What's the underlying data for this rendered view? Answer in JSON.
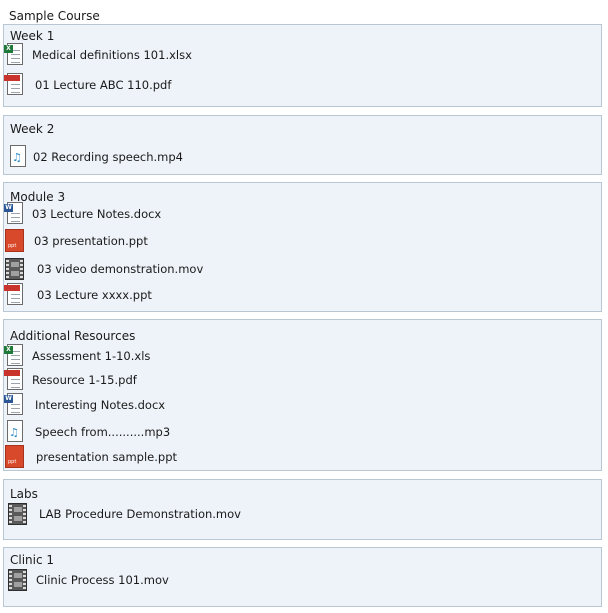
{
  "course": {
    "title": "Sample Course"
  },
  "sections": [
    {
      "title": "Week 1",
      "files": [
        {
          "name": "Medical definitions 101.xlsx",
          "icon": "excel-icon"
        },
        {
          "name": "01 Lecture ABC 110.pdf",
          "icon": "pdf-icon"
        }
      ]
    },
    {
      "title": "Week 2",
      "files": [
        {
          "name": "02 Recording speech.mp4",
          "icon": "audio-icon"
        }
      ]
    },
    {
      "title": "Module 3",
      "files": [
        {
          "name": "03 Lecture Notes.docx",
          "icon": "word-icon"
        },
        {
          "name": "03 presentation.ppt",
          "icon": "powerpoint-icon"
        },
        {
          "name": "03 video demonstration.mov",
          "icon": "video-icon"
        },
        {
          "name": "03 Lecture xxxx.ppt",
          "icon": "pdf-icon"
        }
      ]
    },
    {
      "title": "Additional Resources",
      "files": [
        {
          "name": "Assessment 1-10.xls",
          "icon": "excel-icon"
        },
        {
          "name": "Resource 1-15.pdf",
          "icon": "pdf-icon"
        },
        {
          "name": "Interesting Notes.docx",
          "icon": "word-icon"
        },
        {
          "name": "Speech from..........mp3",
          "icon": "audio-icon"
        },
        {
          "name": "presentation sample.ppt",
          "icon": "powerpoint-icon"
        }
      ]
    },
    {
      "title": "Labs",
      "files": [
        {
          "name": "LAB Procedure Demonstration.mov",
          "icon": "video-icon"
        }
      ]
    },
    {
      "title": "Clinic 1",
      "files": [
        {
          "name": "Clinic Process 101.mov",
          "icon": "video-icon"
        }
      ]
    }
  ],
  "colors": {
    "excel": "#1f7a3a",
    "word": "#2b5797",
    "pdf": "#c8332b",
    "powerpoint": "#d8482a"
  }
}
